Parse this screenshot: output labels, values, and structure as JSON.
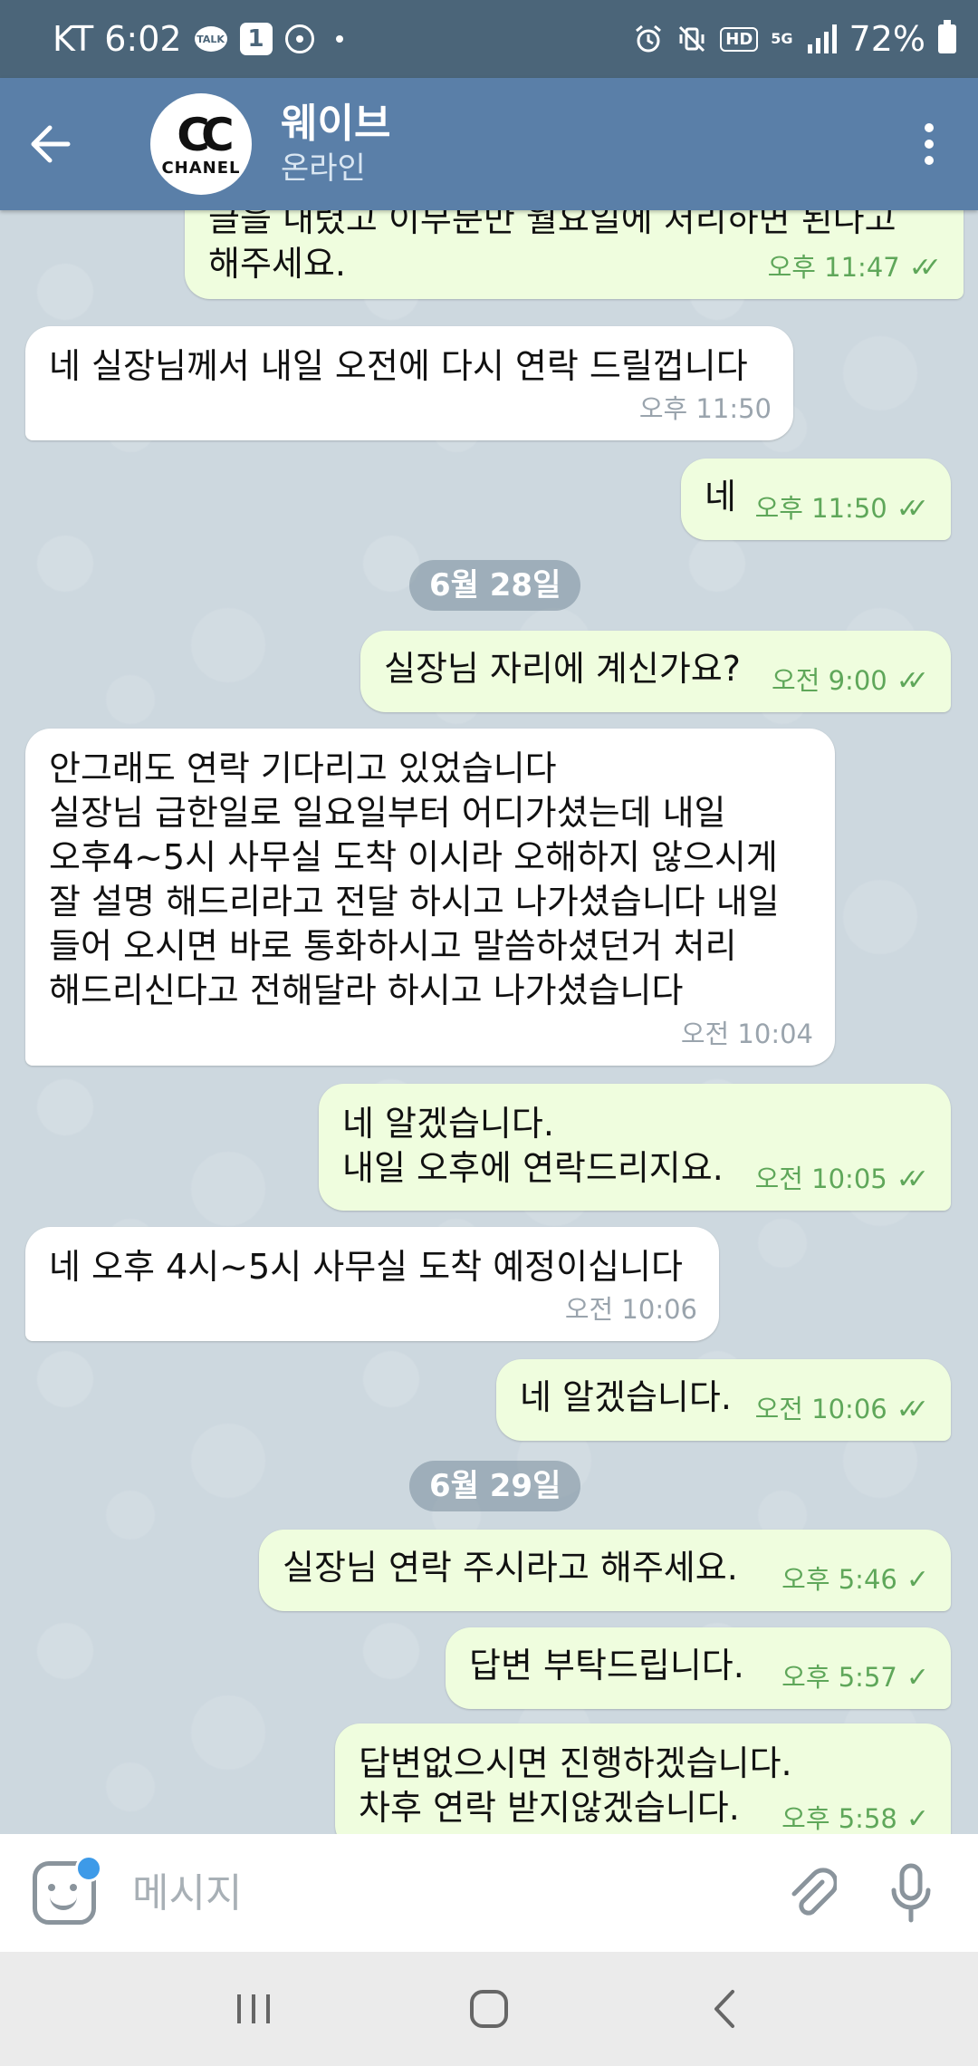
{
  "status_bar": {
    "carrier_time": "KT 6:02",
    "talk_badge": "TALK",
    "notification_count": "1",
    "hd_label": "HD",
    "network_label": "5G",
    "battery": "72%"
  },
  "header": {
    "avatar_brand": "CHANEL",
    "avatar_logo": "CC",
    "contact_name": "웨이브",
    "contact_status": "온라인"
  },
  "messages": [
    {
      "dir": "out",
      "text": "글을 내렸고 이부분만 월요일에 처리하면 된다고\n해주세요.",
      "time": "오후 11:47",
      "ticks": "double"
    },
    {
      "dir": "in",
      "text": "네 실장님께서 내일 오전에 다시 연락 드릴껍니다",
      "time": "오후 11:50"
    },
    {
      "dir": "out",
      "text": "네",
      "time": "오후 11:50",
      "ticks": "double"
    },
    {
      "date": "6월 28일"
    },
    {
      "dir": "out",
      "text": "실장님 자리에 계신가요?",
      "time": "오전 9:00",
      "ticks": "double"
    },
    {
      "dir": "in",
      "text": "안그래도 연락 기다리고 있었습니다\n실장님 급한일로 일요일부터 어디가셨는데 내일\n오후4~5시 사무실 도착 이시라 오해하지 않으시게\n잘 설명 해드리라고 전달 하시고 나가셨습니다 내일\n들어 오시면 바로 통화하시고 말씀하셨던거 처리\n해드리신다고 전해달라 하시고 나가셨습니다",
      "time": "오전 10:04"
    },
    {
      "dir": "out",
      "text": "네 알겠습니다.\n내일 오후에 연락드리지요.",
      "time": "오전 10:05",
      "ticks": "double"
    },
    {
      "dir": "in",
      "text": "네 오후 4시~5시 사무실 도착 예정이십니다",
      "time": "오전 10:06"
    },
    {
      "dir": "out",
      "text": "네 알겠습니다.",
      "time": "오전 10:06",
      "ticks": "double"
    },
    {
      "date": "6월 29일"
    },
    {
      "dir": "out",
      "text": "실장님 연락 주시라고 해주세요.",
      "time": "오후 5:46",
      "ticks": "single"
    },
    {
      "dir": "out",
      "text": "답변 부탁드립니다.",
      "time": "오후 5:57",
      "ticks": "single"
    },
    {
      "dir": "out",
      "text": "답변없으시면 진행하겠습니다.\n차후 연락 받지않겠습니다.",
      "time": "오후 5:58",
      "ticks": "single"
    }
  ],
  "input": {
    "placeholder": "메시지"
  },
  "icons": {
    "back": "arrow-left-icon",
    "menu": "more-vertical-icon",
    "emoji": "sticker-emoji-icon",
    "attach": "paperclip-icon",
    "mic": "microphone-icon",
    "nav_recent": "recent-apps-icon",
    "nav_home": "home-icon",
    "nav_back": "nav-back-icon"
  },
  "colors": {
    "header": "#5a7fa8",
    "status_bar": "#4b6579",
    "outgoing_bubble": "#effdde",
    "incoming_bubble": "#ffffff",
    "time_green": "#5fa75a"
  }
}
